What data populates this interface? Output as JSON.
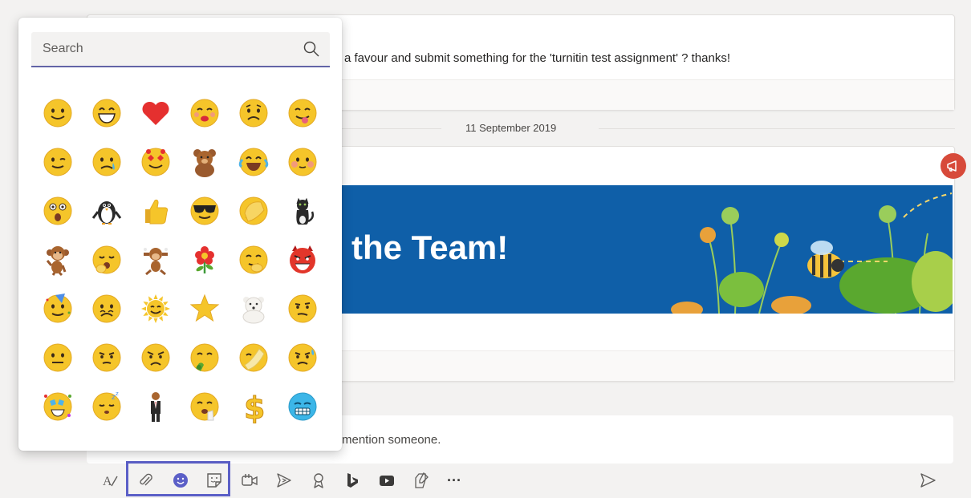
{
  "messages": {
    "first": {
      "text": "a favour and submit something for the 'turnitin test assignment' ? thanks!"
    },
    "date_separator": "11 September 2019",
    "banner": {
      "title": "the Team!"
    }
  },
  "compose": {
    "placeholder_partial": "mention someone."
  },
  "emoji_picker": {
    "search_placeholder": "Search",
    "emojis": [
      "smile",
      "laugh",
      "heart",
      "kiss",
      "sad",
      "tongue-out",
      "wink",
      "cry",
      "in-love",
      "bear",
      "laugh-crying",
      "blush",
      "surprised",
      "penguin",
      "thumbs-up",
      "cool",
      "facepalm",
      "cat",
      "monkey",
      "yawn",
      "hear-no-evil-monkey",
      "flower",
      "giggle",
      "devil",
      "party",
      "sad-face",
      "sun",
      "star",
      "polar-bear",
      "skeptical",
      "speechless",
      "thinking",
      "angry",
      "sick",
      "wondering",
      "sweating",
      "bling",
      "sleepy",
      "businessman",
      "stop",
      "cash",
      "frozen"
    ]
  },
  "toolbar": {
    "icons": [
      "format-icon",
      "attach-icon",
      "emoji-icon",
      "sticker-icon",
      "meet-icon",
      "send-forward-icon",
      "praise-icon",
      "bing-icon",
      "youtube-icon",
      "whiteboard-icon",
      "more-icon"
    ],
    "more_label": "···"
  },
  "colors": {
    "accent": "#6264a7",
    "banner": "#0f5fa8",
    "announcement": "#d74a3a"
  }
}
